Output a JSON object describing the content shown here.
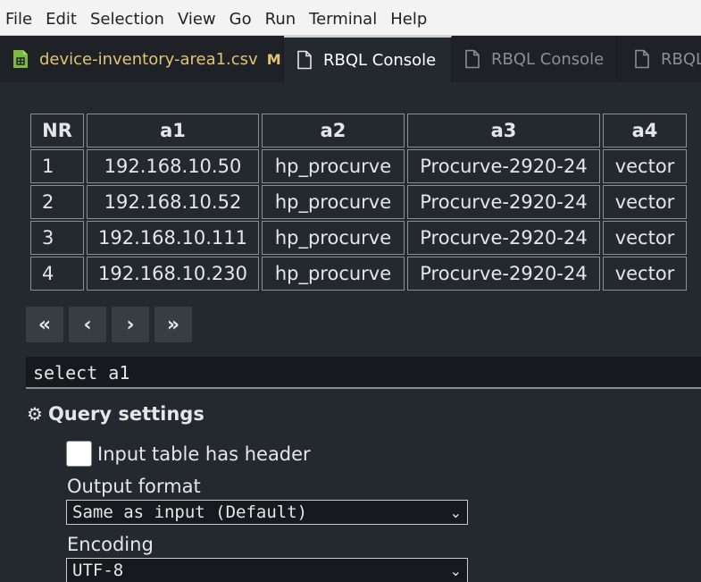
{
  "menubar": {
    "items": [
      "File",
      "Edit",
      "Selection",
      "View",
      "Go",
      "Run",
      "Terminal",
      "Help"
    ]
  },
  "tabs": [
    {
      "label": "device-inventory-area1.csv",
      "badge": "M",
      "icon": "csv-file-icon"
    },
    {
      "label": "RBQL Console",
      "icon": "file-icon"
    },
    {
      "label": "RBQL Console",
      "icon": "file-icon"
    },
    {
      "label": "RBQL",
      "icon": "file-icon"
    }
  ],
  "table": {
    "headers": [
      "NR",
      "a1",
      "a2",
      "a3",
      "a4"
    ],
    "rows": [
      [
        "1",
        "192.168.10.50",
        "hp_procurve",
        "Procurve-2920-24",
        "vector"
      ],
      [
        "2",
        "192.168.10.52",
        "hp_procurve",
        "Procurve-2920-24",
        "vector"
      ],
      [
        "3",
        "192.168.10.111",
        "hp_procurve",
        "Procurve-2920-24",
        "vector"
      ],
      [
        "4",
        "192.168.10.230",
        "hp_procurve",
        "Procurve-2920-24",
        "vector"
      ]
    ]
  },
  "pager": {
    "first": "«",
    "prev": "‹",
    "next": "›",
    "last": "»"
  },
  "query": {
    "value": "select a1"
  },
  "settings": {
    "title": "Query settings",
    "header_checkbox_label": "Input table has header",
    "header_checked": false,
    "output_format_label": "Output format",
    "output_format_value": "Same as input (Default)",
    "encoding_label": "Encoding",
    "encoding_value": "UTF-8"
  },
  "colors": {
    "background": "#24292f",
    "modified_accent": "#e0c474",
    "csv_icon": "#7fb843"
  }
}
